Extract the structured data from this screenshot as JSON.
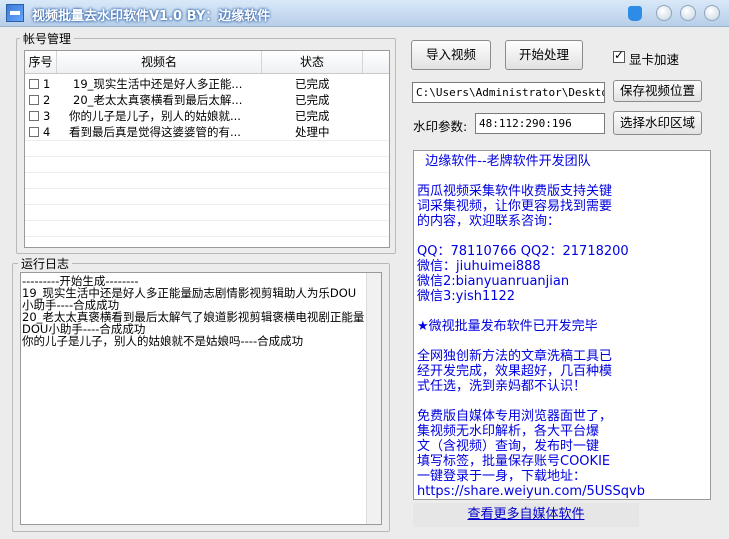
{
  "window": {
    "title": "视频批量去水印软件V1.0 BY：边缘软件",
    "icons": [
      "app-icon",
      "skin-icon",
      "minimize-icon",
      "maximize-icon",
      "close-icon"
    ]
  },
  "account_group": {
    "title": "帐号管理",
    "columns": [
      "序号",
      "视频名",
      "状态"
    ],
    "rows": [
      {
        "num": "1",
        "name": "19_现实生活中还是好人多正能...",
        "status": "已完成"
      },
      {
        "num": "2",
        "name": "20_老太太真褒横看到最后太解...",
        "status": "已完成"
      },
      {
        "num": "3",
        "name": "你的儿子是儿子，别人的姑娘就...",
        "status": "已完成"
      },
      {
        "num": "4",
        "name": "看到最后真是觉得这婆婆管的有...",
        "status": "处理中"
      }
    ]
  },
  "log_group": {
    "title": "运行日志",
    "text": "---------开始生成--------\n19_现实生活中还是好人多正能量励志剧情影视剪辑助人为乐DOU小助手----合成成功\n20_老太太真褒横看到最后太解气了娘道影视剪辑褒横电视剧正能量DOU小助手----合成成功\n你的儿子是儿子，别人的姑娘就不是姑娘吗----合成成功"
  },
  "toolbar": {
    "import_label": "导入视频",
    "start_label": "开始处理",
    "gpu_label": "显卡加速",
    "gpu_checked": true
  },
  "save_path": {
    "value": "C:\\Users\\Administrator\\Desktop\\T",
    "button_label": "保存视频位置"
  },
  "watermark": {
    "label": "水印参数:",
    "value": "48:112:290:196",
    "button_label": "选择水印区域"
  },
  "info_text": "  边缘软件--老牌软件开发团队\n\n西瓜视频采集软件收费版支持关键\n词采集视频，让你更容易找到需要\n的内容，欢迎联系咨询：\n\nQQ：78110766 QQ2：21718200\n微信：jiuhuimei888\n微信2:bianyuanruanjian\n微信3:yish1122\n\n★微视批量发布软件已开发完毕\n\n全网独创新方法的文章洗稿工具已\n经开发完成，效果超好，几百种模\n式任选，洗到亲妈都不认识！\n\n免费版自媒体专用浏览器面世了，\n集视频无水印解析，各大平台爆\n文（含视频）查询，发布时一键\n填写标签，批量保存账号COOKIE\n一键登录于一身，下载地址：\nhttps://share.weiyun.com/5USSqvb",
  "more_link": "查看更多自媒体软件"
}
